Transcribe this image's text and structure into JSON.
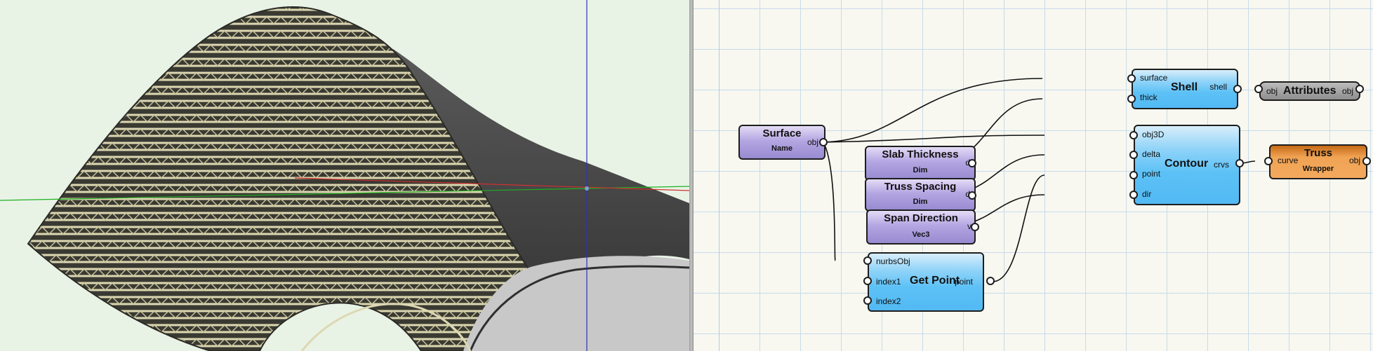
{
  "viewport": {
    "colors": {
      "background": "#e8f3e6",
      "shell": "#4a4a4a",
      "truss": "#ddd8b2",
      "axis_x": "#d03030",
      "axis_y": "#20b020",
      "axis_z": "#3030c0"
    }
  },
  "graph": {
    "colors": {
      "canvas": "#f8f8f1",
      "grid": "#c8dbe8",
      "purple_node": "#a89ad9",
      "blue_node": "#5cc1f6",
      "gray_node": "#9a9a9a",
      "orange_node": "#f3a95d"
    },
    "nodes": {
      "surface": {
        "title": "Surface",
        "sub": "Name",
        "out": "obj"
      },
      "slab": {
        "title": "Slab Thickness",
        "sub": "Dim",
        "out": "d"
      },
      "spacing": {
        "title": "Truss Spacing",
        "sub": "Dim",
        "out": "d"
      },
      "span": {
        "title": "Span Direction",
        "sub": "Vec3",
        "out": "v"
      },
      "getpoint": {
        "title": "Get Point",
        "in": [
          "nurbsObj",
          "index1",
          "index2"
        ],
        "out": "point"
      },
      "shell": {
        "title": "Shell",
        "in": [
          "surface",
          "thick"
        ],
        "out": "shell"
      },
      "attributes": {
        "title": "Attributes",
        "in": "obj",
        "out": "obj"
      },
      "contour": {
        "title": "Contour",
        "in": [
          "obj3D",
          "delta",
          "point",
          "dir"
        ],
        "out": "crvs"
      },
      "truss": {
        "title": "Truss",
        "sub": "Wrapper",
        "in": "curve",
        "out": "obj"
      }
    }
  }
}
